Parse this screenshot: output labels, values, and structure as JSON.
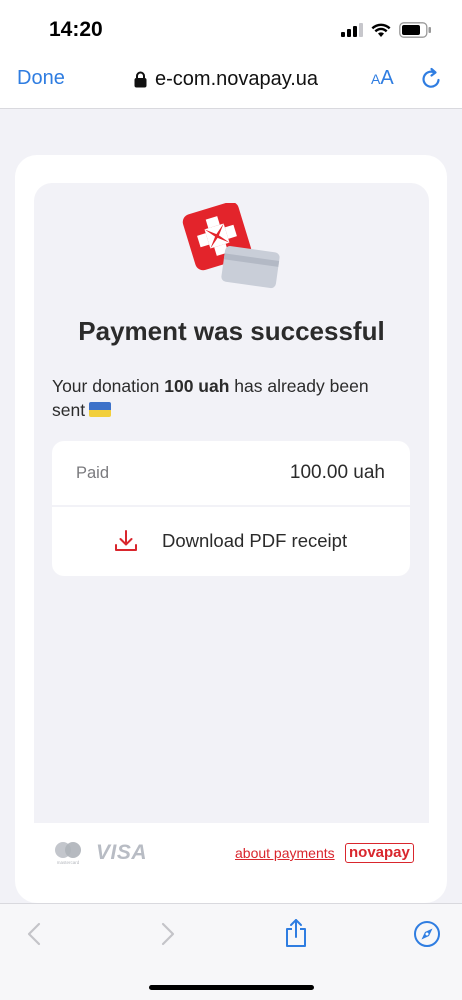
{
  "status_bar": {
    "time": "14:20"
  },
  "browser": {
    "done_label": "Done",
    "url": "e-com.novapay.ua",
    "aa_small": "A",
    "aa_large": "A"
  },
  "payment": {
    "title": "Payment was successful",
    "message_prefix": "Your donation ",
    "amount_bold": "100 uah",
    "message_suffix": " has already been sent",
    "paid_label": "Paid",
    "paid_value": "100.00 uah",
    "download_label": "Download PDF receipt"
  },
  "footer": {
    "visa_label": "VISA",
    "mastercard_caption": "mastercard",
    "about_link": "about payments",
    "brand_label": "novapay"
  },
  "colors": {
    "accent": "#2f7de1",
    "brand_red": "#d9262d",
    "background": "#f2f2f7"
  }
}
